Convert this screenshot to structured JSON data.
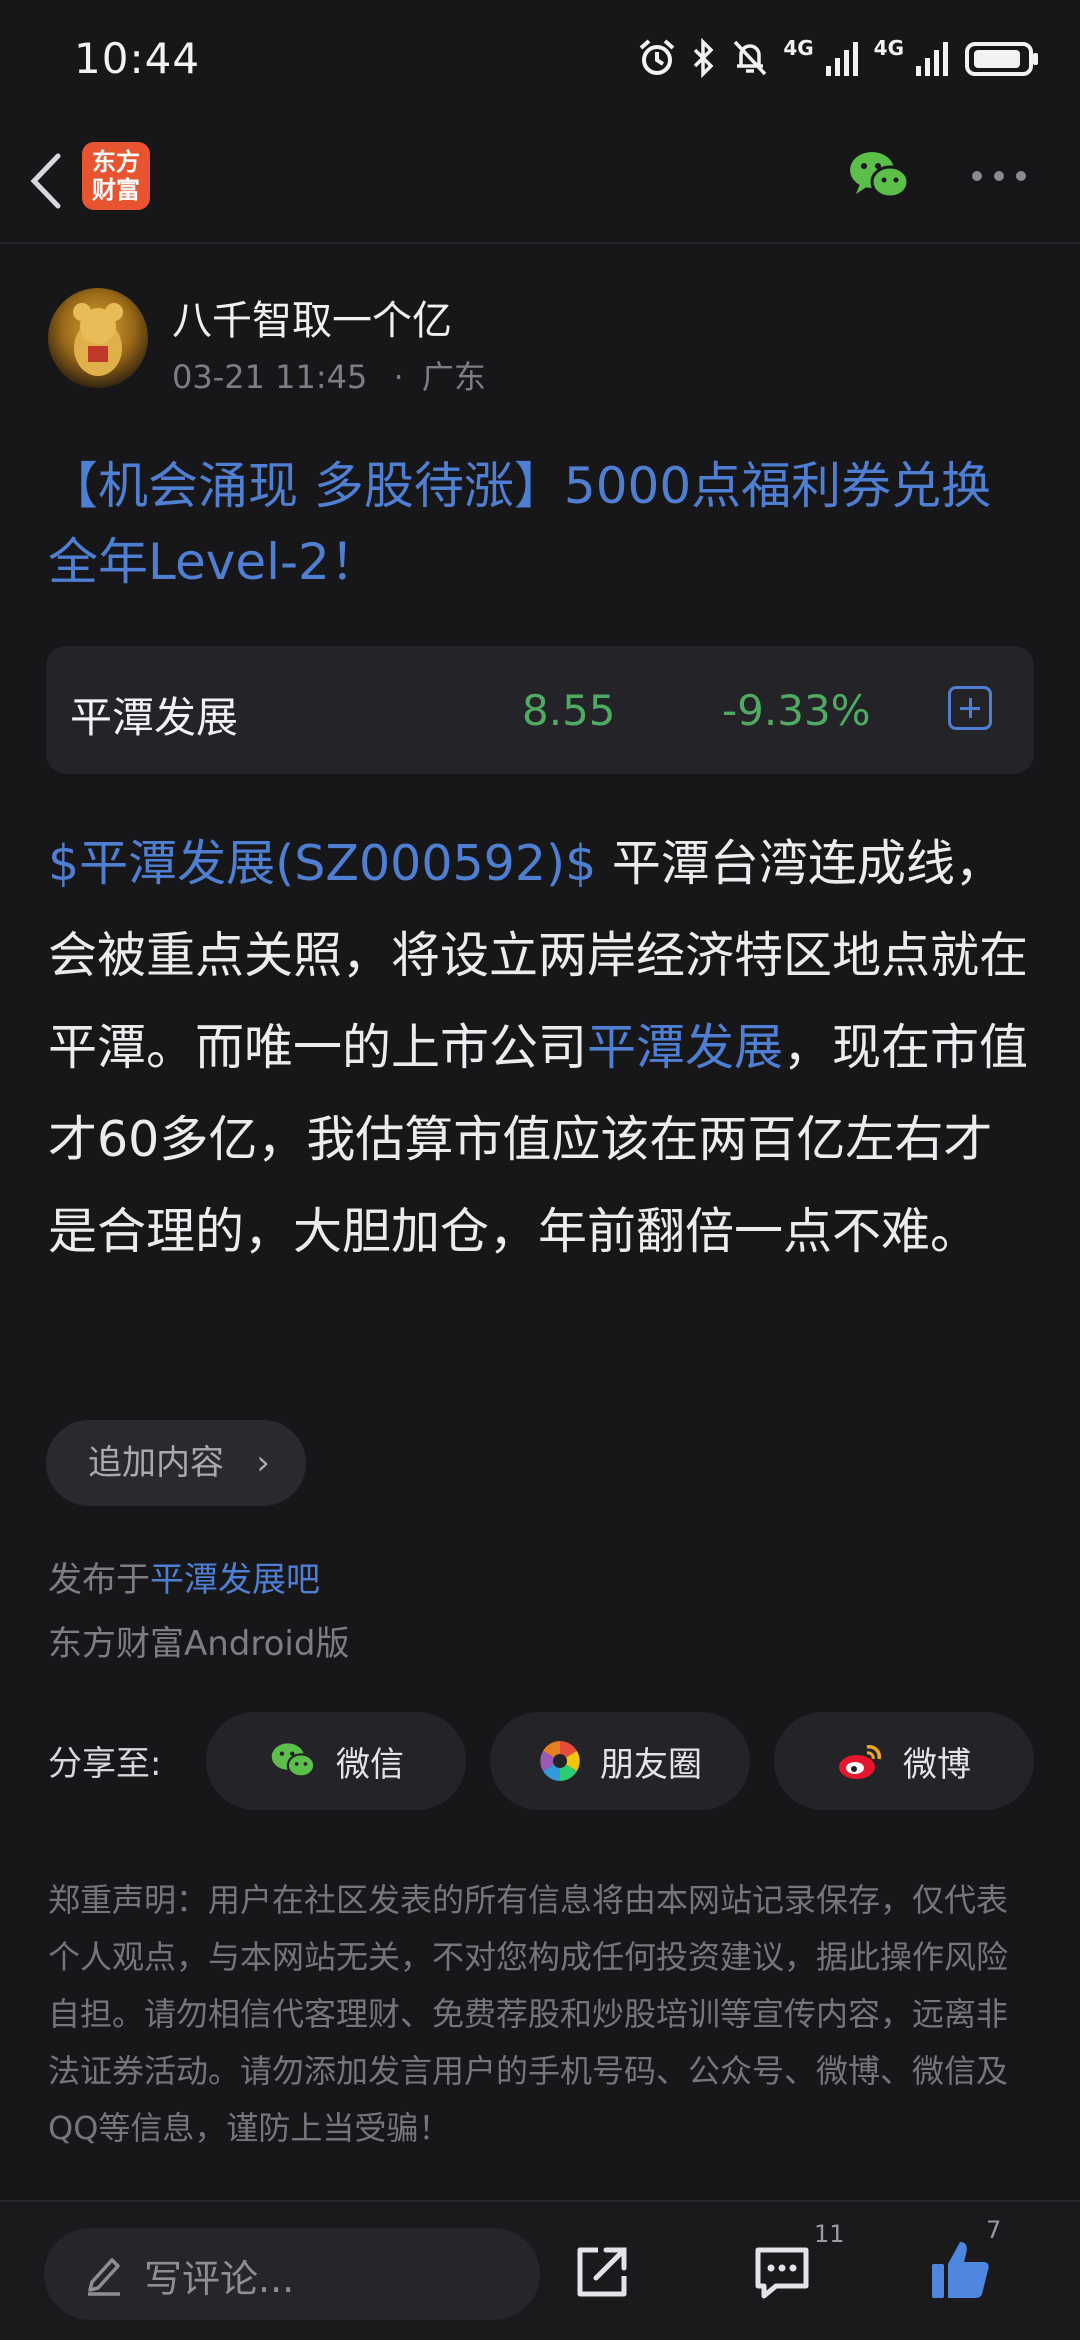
{
  "status_bar": {
    "time": "10:44",
    "net1": "4G",
    "net2": "4G",
    "icons": [
      "alarm-icon",
      "bluetooth-icon",
      "mute-icon",
      "signal-icon",
      "signal-icon",
      "battery-icon"
    ]
  },
  "nav": {
    "logo_line1": "东方",
    "logo_line2": "财富",
    "icons": [
      "back-icon",
      "wechat-icon",
      "more-icon"
    ]
  },
  "author": {
    "name": "八千智取一个亿",
    "datetime": "03-21 11:45",
    "separator": "·",
    "location": "广东"
  },
  "post": {
    "title": "【机会涌现 多股待涨】5000点福利券兑换全年Level-2！",
    "stock_card": {
      "name": "平潭发展",
      "price": "8.55",
      "change": "-9.33%"
    },
    "body_tag": "$平潭发展(SZ000592)$",
    "body_part1": " 平潭台湾连成线，会被重点关照，将设立两岸经济特区地点就在平潭。而唯一的上市公司",
    "body_link": "平潭发展",
    "body_part2": "，现在市值才60多亿，我估算市值应该在两百亿左右才是合理的，大胆加仓，年前翻倍一点不难。"
  },
  "append_button": {
    "label": "追加内容",
    "chevron": "›"
  },
  "published": {
    "prefix": "发布于",
    "forum": "平潭发展吧",
    "client": "东方财富Android版"
  },
  "share": {
    "label": "分享至:",
    "wechat": "微信",
    "moments": "朋友圈",
    "weibo": "微博"
  },
  "disclaimer": "郑重声明：用户在社区发表的所有信息将由本网站记录保存，仅代表个人观点，与本网站无关，不对您构成任何投资建议，据此操作风险自担。请勿相信代客理财、免费荐股和炒股培训等宣传内容，远离非法证券活动。请勿添加发言用户的手机号码、公众号、微博、微信及QQ等信息，谨防上当受骗！",
  "bottom_bar": {
    "comment_placeholder": "写评论...",
    "comment_count": "11",
    "like_count": "7"
  },
  "colors": {
    "background": "#17171a",
    "link_blue": "#4f7fd2",
    "stock_green": "#4faa62",
    "logo_orange": "#e8542f"
  }
}
